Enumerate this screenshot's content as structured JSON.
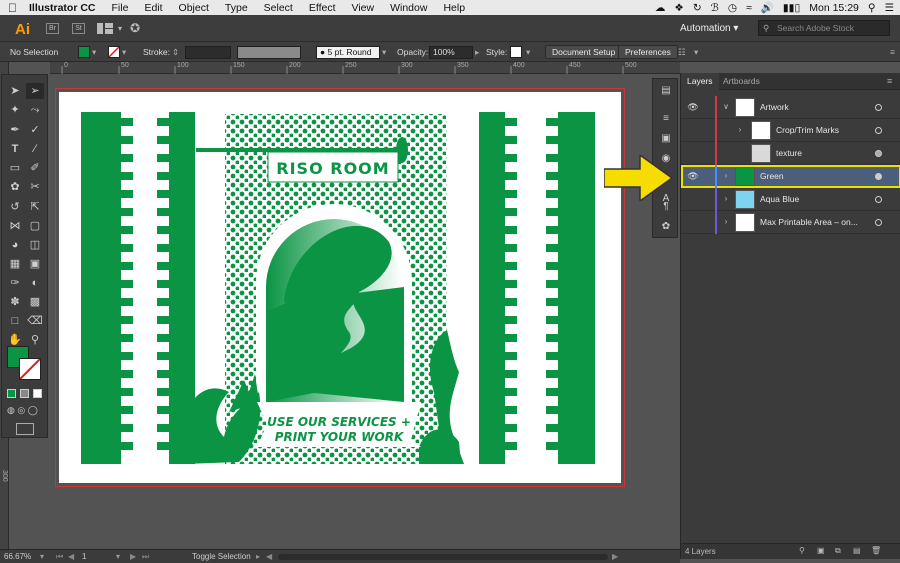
{
  "menubar": {
    "app_name": "Illustrator CC",
    "items": [
      "File",
      "Edit",
      "Object",
      "Type",
      "Select",
      "Effect",
      "View",
      "Window",
      "Help"
    ],
    "clock": "Mon 15:29"
  },
  "appbar": {
    "logo": "Ai",
    "app_icons": [
      "Br",
      "St"
    ],
    "workspace": "Automation",
    "stock_search_placeholder": "Search Adobe Stock"
  },
  "control_bar": {
    "selection_label": "No Selection",
    "fill_color": "#0a9443",
    "stroke_label": "Stroke:",
    "brush_label": "5 pt. Round",
    "opacity_label": "Opacity:",
    "opacity_value": "100%",
    "style_label": "Style:",
    "document_setup": "Document Setup",
    "preferences": "Preferences"
  },
  "ruler": {
    "top_ticks": [
      "0",
      "50",
      "100",
      "150",
      "200",
      "250",
      "300",
      "350",
      "400",
      "450",
      "500",
      "550"
    ],
    "left_tick": "300"
  },
  "tools": {
    "fill_color": "#0a9443",
    "icons": [
      "selection-tool-icon",
      "direct-selection-tool-icon",
      "magic-wand-icon",
      "lasso-icon",
      "pen-icon",
      "curvature-icon",
      "type-icon",
      "line-icon",
      "rectangle-icon",
      "paintbrush-icon",
      "shaper-icon",
      "eraser-icon",
      "rotate-icon",
      "scale-icon",
      "width-icon",
      "free-transform-icon",
      "shape-builder-icon",
      "perspective-icon",
      "mesh-icon",
      "gradient-icon",
      "eyedropper-icon",
      "blend-icon",
      "symbol-sprayer-icon",
      "column-graph-icon",
      "artboard-icon",
      "slice-icon",
      "hand-icon",
      "zoom-icon"
    ]
  },
  "artwork": {
    "green": "#0a9443",
    "title_text": "RISO ROOM",
    "line1": "USE OUR SERVICES +",
    "line2": "PRINT YOUR WORK"
  },
  "layers_panel": {
    "tabs": [
      "Layers",
      "Artboards"
    ],
    "rows": [
      {
        "name": "Artwork",
        "color": "#d23a4c",
        "visible": true,
        "expanded": true
      },
      {
        "name": "Crop/Trim Marks",
        "color": "#d23a4c",
        "visible": false,
        "sublayer": true
      },
      {
        "name": "texture",
        "color": "#d23a4c",
        "visible": false,
        "sublayer": true
      },
      {
        "name": "Green",
        "color": "#4f8cff",
        "visible": true,
        "selected": true
      },
      {
        "name": "Aqua Blue",
        "color": "#6a5bd6",
        "visible": false
      },
      {
        "name": "Max Printable Area – on...",
        "color": "#6a5bd6",
        "visible": false
      }
    ],
    "footer_count": "4 Layers",
    "highlight_color": "#f0e000"
  },
  "status_bar": {
    "zoom": "66.67%",
    "page": "1",
    "tool_status": "Toggle Selection"
  },
  "callout_arrow_color": "#f5dd00"
}
